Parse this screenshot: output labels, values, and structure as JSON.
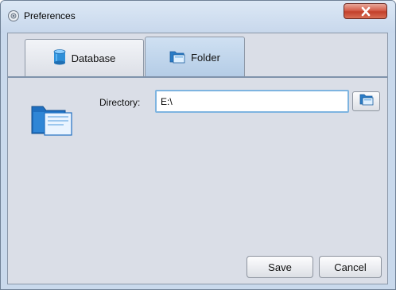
{
  "window": {
    "title": "Preferences"
  },
  "tabs": [
    {
      "label": "Database",
      "icon": "database-icon",
      "selected": false
    },
    {
      "label": "Folder",
      "icon": "folder-icon",
      "selected": true
    }
  ],
  "folder_panel": {
    "directory_label": "Directory:",
    "directory_value": "E:\\",
    "browse_icon": "folder-icon"
  },
  "buttons": {
    "save": "Save",
    "cancel": "Cancel"
  },
  "colors": {
    "close_button": "#d5604c",
    "accent": "#7eb4e0",
    "selected_tab": "#b4cce6"
  }
}
